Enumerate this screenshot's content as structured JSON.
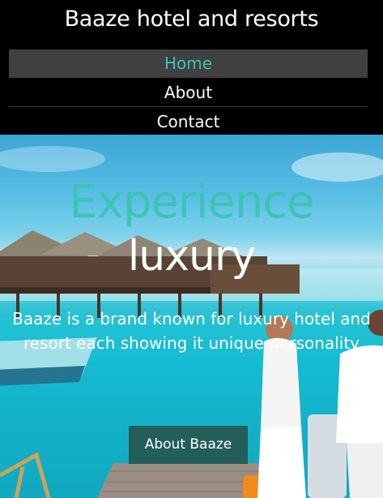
{
  "header": {
    "site_title": "Baaze hotel and resorts",
    "nav": [
      {
        "label": "Home",
        "active": true
      },
      {
        "label": "About",
        "active": false
      },
      {
        "label": "Contact",
        "active": false
      }
    ]
  },
  "hero": {
    "headline_line1": "Experience",
    "headline_line2": "luxury",
    "tagline": "Baaze is a brand known for luxury hotel and resort each showing it unique personality",
    "cta_label": "About Baaze"
  },
  "colors": {
    "accent": "#3cc4b4",
    "button": "#245e5a",
    "nav_active_bg": "#404040"
  }
}
